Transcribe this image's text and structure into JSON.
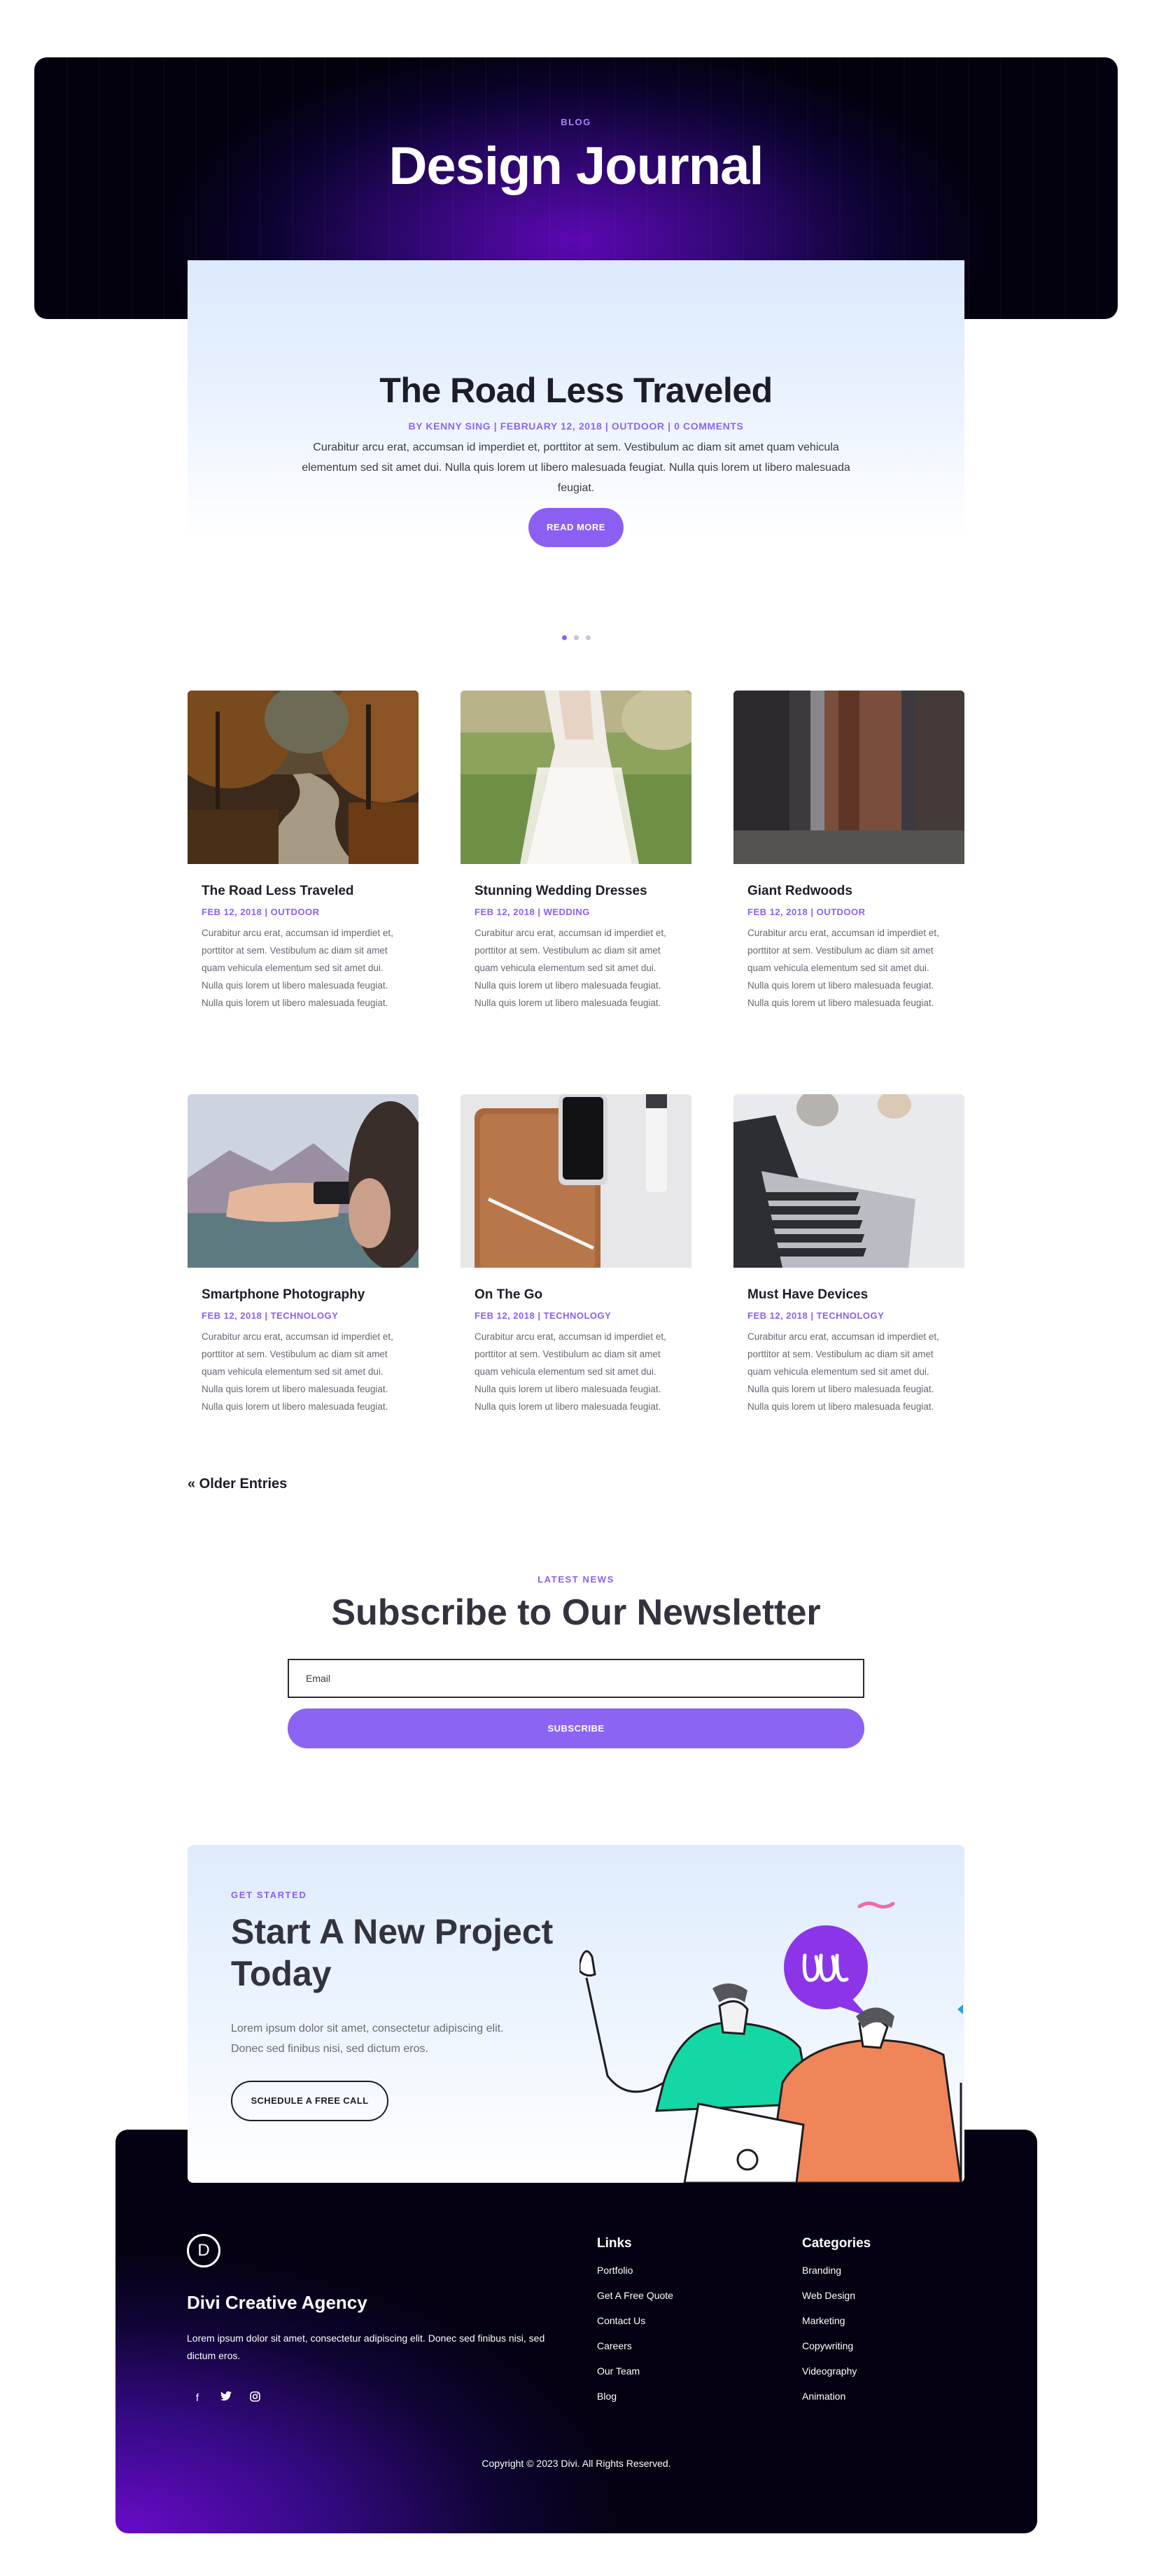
{
  "hero": {
    "eyebrow": "BLOG",
    "title": "Design Journal"
  },
  "featured": {
    "title": "The Road Less Traveled",
    "meta": "BY KENNY SING | FEBRUARY 12, 2018 | OUTDOOR | 0 COMMENTS",
    "excerpt": "Curabitur arcu erat, accumsan id imperdiet et, porttitor at sem. Vestibulum ac diam sit amet quam vehicula elementum sed sit amet dui. Nulla quis lorem ut libero malesuada feugiat. Nulla quis lorem ut libero malesuada feugiat.",
    "button": "READ MORE",
    "slide_count": 3,
    "active_slide": 1
  },
  "posts": [
    {
      "title": "The Road Less Traveled",
      "meta": "FEB 12, 2018 | OUTDOOR",
      "image": "forest-road",
      "excerpt": "Curabitur arcu erat, accumsan id imperdiet et, porttitor at sem. Vestibulum ac diam sit amet quam vehicula elementum sed sit amet dui. Nulla quis lorem ut libero malesuada feugiat. Nulla quis lorem ut libero malesuada feugiat."
    },
    {
      "title": "Stunning Wedding Dresses",
      "meta": "FEB 12, 2018 | WEDDING",
      "image": "wedding-dress",
      "excerpt": "Curabitur arcu erat, accumsan id imperdiet et, porttitor at sem. Vestibulum ac diam sit amet quam vehicula elementum sed sit amet dui. Nulla quis lorem ut libero malesuada feugiat. Nulla quis lorem ut libero malesuada feugiat."
    },
    {
      "title": "Giant Redwoods",
      "meta": "FEB 12, 2018 | OUTDOOR",
      "image": "redwoods",
      "excerpt": "Curabitur arcu erat, accumsan id imperdiet et, porttitor at sem. Vestibulum ac diam sit amet quam vehicula elementum sed sit amet dui. Nulla quis lorem ut libero malesuada feugiat. Nulla quis lorem ut libero malesuada feugiat."
    },
    {
      "title": "Smartphone Photography",
      "meta": "FEB 12, 2018 | TECHNOLOGY",
      "image": "smartphone-photo",
      "excerpt": "Curabitur arcu erat, accumsan id imperdiet et, porttitor at sem. Vestibulum ac diam sit amet quam vehicula elementum sed sit amet dui. Nulla quis lorem ut libero malesuada feugiat. Nulla quis lorem ut libero malesuada feugiat."
    },
    {
      "title": "On The Go",
      "meta": "FEB 12, 2018 | TECHNOLOGY",
      "image": "phone-notebook",
      "excerpt": "Curabitur arcu erat, accumsan id imperdiet et, porttitor at sem. Vestibulum ac diam sit amet quam vehicula elementum sed sit amet dui. Nulla quis lorem ut libero malesuada feugiat. Nulla quis lorem ut libero malesuada feugiat."
    },
    {
      "title": "Must Have Devices",
      "meta": "FEB 12, 2018 | TECHNOLOGY",
      "image": "laptop-keyboard",
      "excerpt": "Curabitur arcu erat, accumsan id imperdiet et, porttitor at sem. Vestibulum ac diam sit amet quam vehicula elementum sed sit amet dui. Nulla quis lorem ut libero malesuada feugiat. Nulla quis lorem ut libero malesuada feugiat."
    }
  ],
  "pagination": {
    "older": "« Older Entries"
  },
  "newsletter": {
    "eyebrow": "LATEST NEWS",
    "title": "Subscribe to Our Newsletter",
    "email_placeholder": "Email",
    "button": "SUBSCRIBE"
  },
  "cta": {
    "eyebrow": "GET STARTED",
    "title": "Start A New Project Today",
    "text": "Lorem ipsum dolor sit amet, consectetur adipiscing elit. Donec sed finibus nisi, sed dictum eros.",
    "button": "SCHEDULE A FREE CALL"
  },
  "footer": {
    "logo_letter": "D",
    "brand": "Divi Creative Agency",
    "description": "Lorem ipsum dolor sit amet, consectetur adipiscing elit. Donec sed finibus nisi, sed dictum eros.",
    "social": [
      "facebook-icon",
      "twitter-icon",
      "instagram-icon"
    ],
    "links": {
      "title": "Links",
      "items": [
        "Portfolio",
        "Get A Free Quote",
        "Contact Us",
        "Careers",
        "Our Team",
        "Blog"
      ]
    },
    "categories": {
      "title": "Categories",
      "items": [
        "Branding",
        "Web Design",
        "Marketing",
        "Copywriting",
        "Videography",
        "Animation"
      ]
    },
    "copyright": "Copyright © 2023 Divi. All Rights Reserved."
  },
  "colors": {
    "accent": "#8c5ff3",
    "dark": "#1d1d2a",
    "hero_purple": "#5b08b3"
  }
}
